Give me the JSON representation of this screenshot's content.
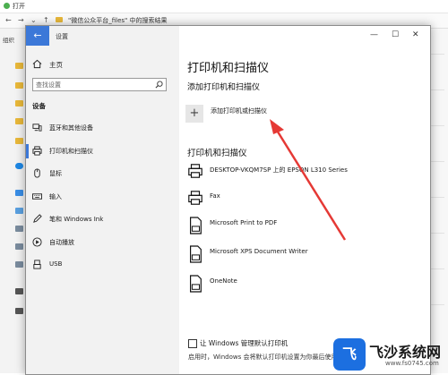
{
  "background_window": {
    "title": "打开",
    "path": "\"微信公众平台_files\" 中的搜索结果",
    "left_label": "组织"
  },
  "settings_window": {
    "title": "设置",
    "controls": {
      "minimize": "—",
      "maximize": "☐",
      "close": "✕"
    }
  },
  "sidebar": {
    "home_label": "主页",
    "search_placeholder": "查找设置",
    "section_heading": "设备",
    "items": [
      {
        "label": "蓝牙和其他设备",
        "icon": "bluetooth-devices-icon"
      },
      {
        "label": "打印机和扫描仪",
        "icon": "printer-icon",
        "active": true
      },
      {
        "label": "鼠标",
        "icon": "mouse-icon"
      },
      {
        "label": "输入",
        "icon": "keyboard-icon"
      },
      {
        "label": "笔和 Windows Ink",
        "icon": "pen-icon"
      },
      {
        "label": "自动播放",
        "icon": "autoplay-icon"
      },
      {
        "label": "USB",
        "icon": "usb-icon"
      }
    ]
  },
  "content": {
    "page_title": "打印机和扫描仪",
    "add_heading": "添加打印机和扫描仪",
    "add_button_symbol": "+",
    "add_button_label": "添加打印机或扫描仪",
    "list_heading": "打印机和扫描仪",
    "devices": [
      {
        "name": "DESKTOP-VKQM7SP 上的 EPSON L310 Series",
        "icon": "printer-icon"
      },
      {
        "name": "Fax",
        "icon": "fax-icon"
      },
      {
        "name": "Microsoft Print to PDF",
        "icon": "pdf-printer-icon"
      },
      {
        "name": "Microsoft XPS Document Writer",
        "icon": "xps-printer-icon"
      },
      {
        "name": "OneNote",
        "icon": "onenote-printer-icon"
      }
    ],
    "footer_checkbox_label": "让 Windows 管理默认打印机",
    "footer_checkbox_checked": false,
    "footer_note": "启用时，Windows 会将默认打印机设置为你最后使用的打印机。"
  },
  "annotation": {
    "arrow_color": "#e53935"
  },
  "watermark": {
    "logo_glyph": "飞",
    "text": "飞沙系统网",
    "url": "www.fs0745.com"
  },
  "colors": {
    "accent": "#3c78d8",
    "sidebar_bg": "#f2f2f2"
  }
}
